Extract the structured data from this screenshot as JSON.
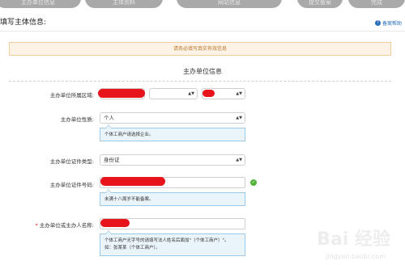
{
  "steps": [
    "主办单位信息",
    "主体资料",
    "网站信息",
    "提交备案",
    "完成"
  ],
  "header": {
    "title": "填写主体信息:",
    "help_label": "备案帮助"
  },
  "notice": "请务必填写真实有效信息",
  "section_title": "主办单位信息",
  "fields": {
    "region": {
      "label": "主办单位所属区域:"
    },
    "nature": {
      "label": "主办单位性质:",
      "value": "个人",
      "hint": "个体工商户请选择企业。"
    },
    "cert_type": {
      "label": "主办单位证件类型:",
      "value": "身份证"
    },
    "cert_number": {
      "label": "主办单位证件号码:",
      "hint": "未满十八周岁不能备案。"
    },
    "holder_name": {
      "required_mark": "*",
      "label": "主办单位或主办人名称:",
      "hint_line1": "个体工商户无字号的请填写法人姓名后面加\"（个体工商户）\"。",
      "hint_line2": "如：张某某（个体工商户）。"
    }
  },
  "watermark": {
    "main": "Bai 经验",
    "sub": "jingyan.baidu.com"
  }
}
